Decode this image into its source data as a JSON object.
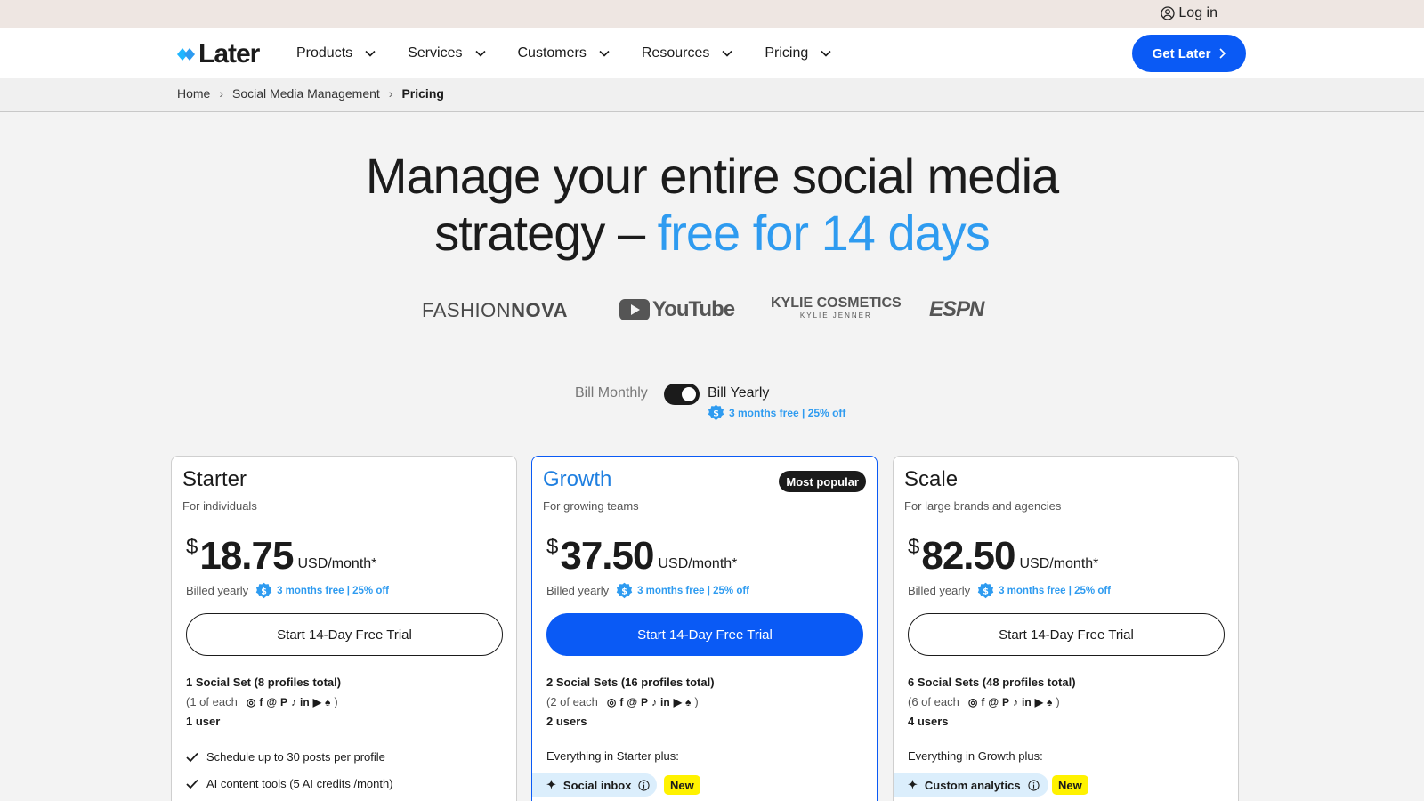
{
  "topbar": {
    "login_label": "Log in"
  },
  "nav": {
    "logo_text": "Later",
    "items": [
      {
        "label": "Products"
      },
      {
        "label": "Services"
      },
      {
        "label": "Customers"
      },
      {
        "label": "Resources"
      },
      {
        "label": "Pricing"
      }
    ],
    "cta_label": "Get Later"
  },
  "breadcrumb": {
    "items": [
      "Home",
      "Social Media Management",
      "Pricing"
    ]
  },
  "hero": {
    "line1": "Manage your entire social media",
    "line2_prefix": "strategy – ",
    "line2_accent": "free for 14 days"
  },
  "brands": {
    "fashion_light": "FASHION",
    "fashion_bold": "NOVA",
    "youtube": "YouTube",
    "kylie_main": "KYLIE COSMETICS",
    "kylie_sub": "KYLIE JENNER",
    "espn": "ESPN"
  },
  "billing": {
    "monthly_label": "Bill Monthly",
    "yearly_label": "Bill Yearly",
    "yearly_selected": true,
    "yearly_note": "3 months free | 25% off"
  },
  "colors": {
    "accent_blue": "#2e9bf0",
    "cta_blue": "#0a5af5",
    "new_badge": "#fff200",
    "highlight_bg": "#dbeefc"
  },
  "plans": [
    {
      "name": "Starter",
      "subtitle": "For individuals",
      "currency": "$",
      "price": "18.75",
      "unit": "USD/month*",
      "billed": "Billed yearly",
      "billed_note": "3 months free | 25% off",
      "cta": "Start 14-Day Free Trial",
      "sets": "1 Social Set (8 profiles total)",
      "each": "(1 of each",
      "users": "1 user",
      "features": [
        "Schedule up to 30 posts per profile",
        "AI content tools (5 AI credits /month)"
      ]
    },
    {
      "name": "Growth",
      "subtitle": "For growing teams",
      "badge": "Most popular",
      "currency": "$",
      "price": "37.50",
      "unit": "USD/month*",
      "billed": "Billed yearly",
      "billed_note": "3 months free | 25% off",
      "cta": "Start 14-Day Free Trial",
      "sets": "2 Social Sets (16 profiles total)",
      "each": "(2 of each",
      "users": "2 users",
      "plus_label": "Everything in Starter plus:",
      "highlight": "Social inbox",
      "new_label": "New"
    },
    {
      "name": "Scale",
      "subtitle": "For large brands and agencies",
      "currency": "$",
      "price": "82.50",
      "unit": "USD/month*",
      "billed": "Billed yearly",
      "billed_note": "3 months free | 25% off",
      "cta": "Start 14-Day Free Trial",
      "sets": "6 Social Sets (48 profiles total)",
      "each": "(6 of each",
      "users": "4 users",
      "plus_label": "Everything in Growth plus:",
      "highlight": "Custom analytics",
      "new_label": "New"
    }
  ],
  "social_icons": [
    "instagram-icon",
    "facebook-icon",
    "threads-icon",
    "pinterest-icon",
    "tiktok-icon",
    "linkedin-icon",
    "youtube-icon",
    "snapchat-icon"
  ]
}
